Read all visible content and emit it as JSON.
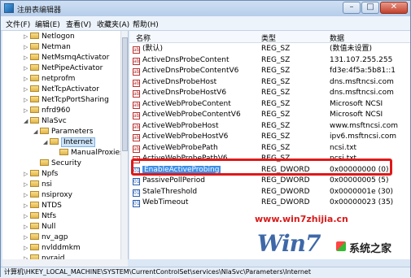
{
  "window": {
    "title": "注册表编辑器"
  },
  "menu": [
    "文件(F)",
    "编辑(E)",
    "查看(V)",
    "收藏夹(A)",
    "帮助(H)"
  ],
  "tree": [
    {
      "label": "Netlogon",
      "indent": 0,
      "expand": "▷"
    },
    {
      "label": "Netman",
      "indent": 0,
      "expand": "▷"
    },
    {
      "label": "NetMsmqActivator",
      "indent": 0,
      "expand": "▷"
    },
    {
      "label": "NetPipeActivator",
      "indent": 0,
      "expand": "▷"
    },
    {
      "label": "netprofm",
      "indent": 0,
      "expand": "▷"
    },
    {
      "label": "NetTcpActivator",
      "indent": 0,
      "expand": "▷"
    },
    {
      "label": "NetTcpPortSharing",
      "indent": 0,
      "expand": "▷"
    },
    {
      "label": "nfrd960",
      "indent": 0,
      "expand": "▷"
    },
    {
      "label": "NlaSvc",
      "indent": 0,
      "expand": "◢"
    },
    {
      "label": "Parameters",
      "indent": 1,
      "expand": "◢"
    },
    {
      "label": "Internet",
      "indent": 2,
      "expand": "◢",
      "selected": true
    },
    {
      "label": "ManualProxies",
      "indent": 3,
      "expand": ""
    },
    {
      "label": "Security",
      "indent": 1,
      "expand": ""
    },
    {
      "label": "Npfs",
      "indent": 0,
      "expand": "▷"
    },
    {
      "label": "nsi",
      "indent": 0,
      "expand": "▷"
    },
    {
      "label": "nsiproxy",
      "indent": 0,
      "expand": "▷"
    },
    {
      "label": "NTDS",
      "indent": 0,
      "expand": "▷"
    },
    {
      "label": "Ntfs",
      "indent": 0,
      "expand": "▷"
    },
    {
      "label": "Null",
      "indent": 0,
      "expand": "▷"
    },
    {
      "label": "nv_agp",
      "indent": 0,
      "expand": "▷"
    },
    {
      "label": "nvlddmkm",
      "indent": 0,
      "expand": "▷"
    },
    {
      "label": "nvraid",
      "indent": 0,
      "expand": "▷"
    }
  ],
  "columns": {
    "name": "名称",
    "type": "类型",
    "data": "数据"
  },
  "values": [
    {
      "name": "(默认)",
      "type": "REG_SZ",
      "data": "(数值未设置)",
      "kind": "ab"
    },
    {
      "name": "ActiveDnsProbeContent",
      "type": "REG_SZ",
      "data": "131.107.255.255",
      "kind": "ab"
    },
    {
      "name": "ActiveDnsProbeContentV6",
      "type": "REG_SZ",
      "data": "fd3e:4f5a:5b81::1",
      "kind": "ab"
    },
    {
      "name": "ActiveDnsProbeHost",
      "type": "REG_SZ",
      "data": "dns.msftncsi.com",
      "kind": "ab"
    },
    {
      "name": "ActiveDnsProbeHostV6",
      "type": "REG_SZ",
      "data": "dns.msftncsi.com",
      "kind": "ab"
    },
    {
      "name": "ActiveWebProbeContent",
      "type": "REG_SZ",
      "data": "Microsoft NCSI",
      "kind": "ab"
    },
    {
      "name": "ActiveWebProbeContentV6",
      "type": "REG_SZ",
      "data": "Microsoft NCSI",
      "kind": "ab"
    },
    {
      "name": "ActiveWebProbeHost",
      "type": "REG_SZ",
      "data": "www.msftncsi.com",
      "kind": "ab"
    },
    {
      "name": "ActiveWebProbeHostV6",
      "type": "REG_SZ",
      "data": "ipv6.msftncsi.com",
      "kind": "ab"
    },
    {
      "name": "ActiveWebProbePath",
      "type": "REG_SZ",
      "data": "ncsi.txt",
      "kind": "ab"
    },
    {
      "name": "ActiveWebProbePathV6",
      "type": "REG_SZ",
      "data": "ncsi.txt",
      "kind": "ab"
    },
    {
      "name": "EnableActiveProbing",
      "type": "REG_DWORD",
      "data": "0x00000000 (0)",
      "kind": "dw",
      "highlight": true
    },
    {
      "name": "PassivePollPeriod",
      "type": "REG_DWORD",
      "data": "0x00000005 (5)",
      "kind": "dw"
    },
    {
      "name": "StaleThreshold",
      "type": "REG_DWORD",
      "data": "0x0000001e (30)",
      "kind": "dw"
    },
    {
      "name": "WebTimeout",
      "type": "REG_DWORD",
      "data": "0x00000023 (35)",
      "kind": "dw"
    }
  ],
  "status": "计算机\\HKEY_LOCAL_MACHINE\\SYSTEM\\CurrentControlSet\\services\\NlaSvc\\Parameters\\Internet",
  "watermark": {
    "url": "www.win7zhijia.cn",
    "logo": "Win7",
    "site": "系统之家"
  },
  "colors": {
    "highlight_border": "#e01818",
    "selection": "#3d8ee6"
  }
}
